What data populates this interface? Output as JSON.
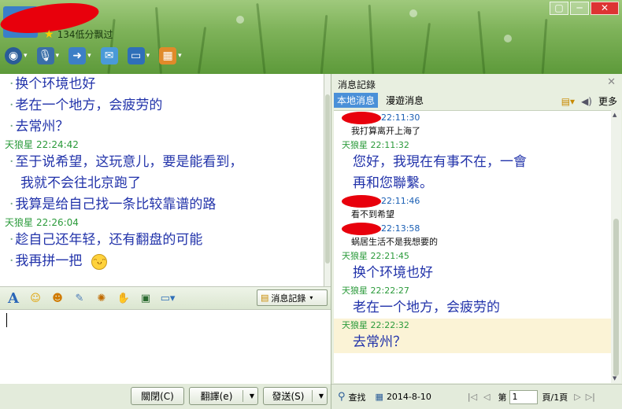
{
  "title_bar": {
    "status_text": "134低分飘过",
    "window_buttons": [
      "▢",
      "─",
      "✕"
    ]
  },
  "toolbar": {
    "icons": [
      "camera-icon",
      "microphone-icon",
      "file-transfer-icon",
      "sms-icon",
      "screen-share-icon",
      "apps-icon"
    ]
  },
  "chat": {
    "lines": [
      {
        "type": "msg",
        "text": "换个环境也好"
      },
      {
        "type": "msg",
        "text": "老在一个地方，会疲劳的"
      },
      {
        "type": "msg",
        "text": "去常州？"
      },
      {
        "type": "sender",
        "name": "天狼星",
        "time": "22:24:42"
      },
      {
        "type": "msg",
        "text": "至于说希望，这玩意儿，要是能看到，"
      },
      {
        "type": "cont",
        "text": "我就不会往北京跑了"
      },
      {
        "type": "msg",
        "text": "我算是给自己找一条比较靠谱的路"
      },
      {
        "type": "sender",
        "name": "天狼星",
        "time": "22:26:04"
      },
      {
        "type": "msg",
        "text": "趁自己还年轻，还有翻盘的可能"
      },
      {
        "type": "msg",
        "text": "我再拼一把"
      }
    ]
  },
  "input_toolbar": {
    "history_label": "消息記錄"
  },
  "bottom_buttons": {
    "close": "關閉(C)",
    "translate": "翻譯(e)",
    "send": "發送(S)"
  },
  "history": {
    "title": "消息記錄",
    "tabs": [
      "本地消息",
      "漫遊消息"
    ],
    "more_label": "更多",
    "entries": [
      {
        "who": "other",
        "name": "",
        "time": "22:11:30",
        "text": "我打算离开上海了",
        "style": "small"
      },
      {
        "who": "self",
        "name": "天狼星",
        "time": "22:11:32",
        "text": "您好，我現在有事不在，一會",
        "text2": "再和您聯繫。",
        "style": "big"
      },
      {
        "who": "other",
        "name": "",
        "time": "22:11:46",
        "text": "看不到希望",
        "style": "small"
      },
      {
        "who": "other",
        "name": "",
        "time": "22:13:58",
        "text": "蜗居生活不是我想要的",
        "style": "small"
      },
      {
        "who": "self",
        "name": "天狼星",
        "time": "22:21:45",
        "text": "换个环境也好",
        "style": "big"
      },
      {
        "who": "self",
        "name": "天狼星",
        "time": "22:22:27",
        "text": "老在一个地方，会疲劳的",
        "style": "big"
      },
      {
        "who": "self",
        "name": "天狼星",
        "time": "22:22:32",
        "text": "去常州？",
        "style": "big",
        "highlight": true
      }
    ],
    "footer": {
      "search_label": "查找",
      "date": "2014-8-10",
      "page_prefix": "第",
      "page_value": "1",
      "page_suffix": "頁/1頁"
    }
  },
  "colors": {
    "accent_green": "#2a9a3a",
    "message_blue": "#2233aa",
    "redaction_red": "#e8000c"
  }
}
